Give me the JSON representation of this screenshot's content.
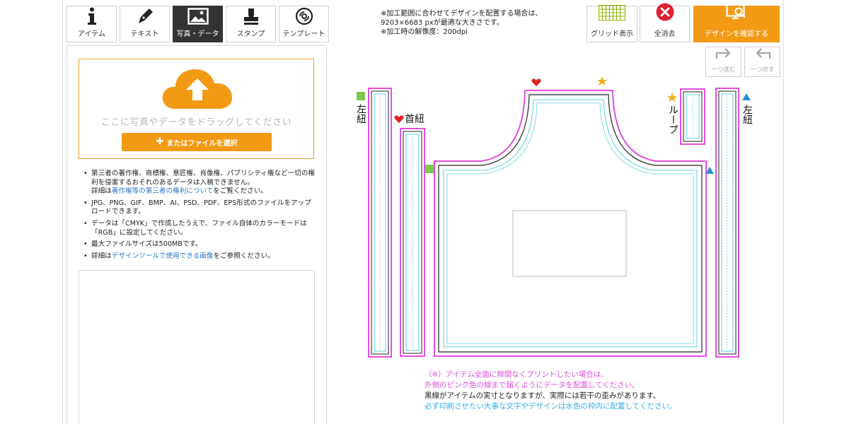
{
  "tabs": [
    {
      "label": "アイテム",
      "icon": "info-icon"
    },
    {
      "label": "テキスト",
      "icon": "pen-icon"
    },
    {
      "label": "写真・データ",
      "icon": "image-icon",
      "active": true
    },
    {
      "label": "スタンプ",
      "icon": "stamp-icon"
    },
    {
      "label": "テンプレート",
      "icon": "disc-icon"
    }
  ],
  "upload": {
    "drag_text": "ここに写真やデータをドラッグしてください",
    "button_label": "またはファイルを選択"
  },
  "notes": {
    "n1": "第三者の著作権、商標権、意匠権、肖像権、パブリシティ権など一切の権利を侵害するおそれのあるデータは入稿できません。",
    "n1b_prefix": "詳細は",
    "n1b_link": "著作権等の第三者の権利について",
    "n1b_suffix": "をご覧ください。",
    "n2": "JPG、PNG、GIF、BMP、AI、PSD、PDF、EPS形式のファイルをアップロードできます。",
    "n3": "データは「CMYK」で作成したうえで、ファイル自体のカラーモードは「RGB」に設定してください。",
    "n4": "最大ファイルサイズは500MBです。",
    "n5_prefix": "詳細は",
    "n5_link": "デザインツールで使用できる画像",
    "n5_suffix": "をご参照ください。"
  },
  "info": {
    "line1": "※加工範囲に合わせてデザインを配置する場合は、",
    "line2": "9203×6683 pxが最適な大きさです。",
    "line3": "※加工時の解像度：200dpi"
  },
  "toolbar": {
    "grid_label": "グリッド表示",
    "clear_label": "全消去",
    "confirm_label": "デザインを確認する",
    "redo_label": "一つ進む",
    "undo_label": "一つ戻す"
  },
  "canvas": {
    "left_tie_label": "左紐",
    "neck_label": "首紐",
    "loop_label": "ループ",
    "right_tie_label": "左紐"
  },
  "bottom_notes": {
    "line1": "（※）アイテム全面に隙間なくプリントしたい場合は、",
    "line2": "外側のピンク色の線まで届くようにデータを配置してください。",
    "line3": "黒線がアイテムの実寸となりますが、実際には若干の歪みがあります。",
    "line4": "必ず印刷させたい大事な文字やデザインは水色の枠内に配置してください。"
  },
  "colors": {
    "accent": "#f39a15",
    "bleed_line": "#e34ee0",
    "safe_line": "#5ccfe6",
    "clear_red": "#e02030"
  }
}
